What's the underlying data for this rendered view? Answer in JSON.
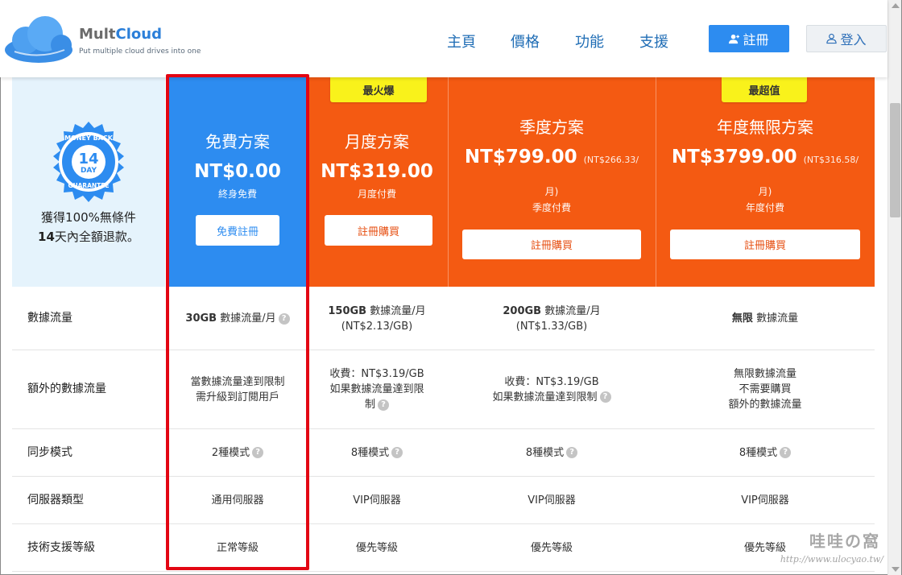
{
  "header": {
    "logo_name_part1": "Mult",
    "logo_name_part2": "Cloud",
    "logo_tagline": "Put multiple cloud drives into one",
    "nav": [
      "主頁",
      "價格",
      "功能",
      "支援"
    ],
    "signup_label": "註冊",
    "login_label": "登入"
  },
  "guarantee": {
    "badge_top": "MONEY BACK",
    "badge_number": "14",
    "badge_day": "DAY",
    "badge_bottom": "GUARANTEE",
    "line1": "獲得100%無條件",
    "line2_bold": "14",
    "line2_rest": "天內全額退款。"
  },
  "plans": [
    {
      "name": "免費方案",
      "price": "NT$0.00",
      "price_sub": "",
      "price_sub2": "",
      "period": "終身免費",
      "cta": "免費註冊",
      "tag": ""
    },
    {
      "name": "月度方案",
      "price": "NT$319.00",
      "price_sub": "",
      "price_sub2": "",
      "period": "月度付費",
      "cta": "註冊購買",
      "tag": "最火爆"
    },
    {
      "name": "季度方案",
      "price": "NT$799.00",
      "price_sub": "(NT$266.33/",
      "price_sub2": "月)",
      "period": "季度付費",
      "cta": "註冊購買",
      "tag": ""
    },
    {
      "name": "年度無限方案",
      "price": "NT$3799.00",
      "price_sub": "(NT$316.58/",
      "price_sub2": "月)",
      "period": "年度付費",
      "cta": "註冊購買",
      "tag": "最超值"
    }
  ],
  "features": [
    {
      "label": "數據流量",
      "values": [
        {
          "bold": "30GB",
          "text": " 數據流量/月",
          "line2": "",
          "q": true
        },
        {
          "bold": "150GB",
          "text": " 數據流量/月",
          "line2": "(NT$2.13/GB)",
          "q": false
        },
        {
          "bold": "200GB",
          "text": " 數據流量/月",
          "line2": "(NT$1.33/GB)",
          "q": false
        },
        {
          "bold": "無限",
          "text": " 數據流量",
          "line2": "",
          "q": false
        }
      ]
    },
    {
      "label": "額外的數據流量",
      "values": [
        {
          "bold": "",
          "text": "當數據流量達到限制",
          "line2": "需升級到訂閱用戶",
          "line3": "",
          "q": false
        },
        {
          "bold": "",
          "text": "收費：NT$3.19/GB",
          "line2": "如果數據流量達到限",
          "line3": "制",
          "q": true
        },
        {
          "bold": "",
          "text": "收費：NT$3.19/GB",
          "line2": "如果數據流量達到限制",
          "line3": "",
          "q": true
        },
        {
          "bold": "",
          "text": "無限數據流量",
          "line2": "不需要購買",
          "line3": "額外的數據流量",
          "q": false
        }
      ]
    },
    {
      "label": "同步模式",
      "values": [
        {
          "text": "2種模式",
          "q": true
        },
        {
          "text": "8種模式",
          "q": true
        },
        {
          "text": "8種模式",
          "q": true
        },
        {
          "text": "8種模式",
          "q": true
        }
      ]
    },
    {
      "label": "伺服器類型",
      "values": [
        {
          "text": "通用伺服器",
          "q": false
        },
        {
          "text": "VIP伺服器",
          "q": false
        },
        {
          "text": "VIP伺服器",
          "q": false
        },
        {
          "text": "VIP伺服器",
          "q": false
        }
      ]
    },
    {
      "label": "技術支援等級",
      "values": [
        {
          "text": "正常等級",
          "q": false
        },
        {
          "text": "優先等級",
          "q": false
        },
        {
          "text": "優先等級",
          "q": false
        },
        {
          "text": "優先等級",
          "q": false
        }
      ]
    }
  ],
  "watermark": {
    "title": "哇哇の窩",
    "url": "http://www.ulocyao.tw/"
  },
  "colors": {
    "blue": "#2d8cf0",
    "orange": "#f45a12",
    "tag_yellow": "#f9f21b",
    "highlight_red": "#e30613"
  }
}
